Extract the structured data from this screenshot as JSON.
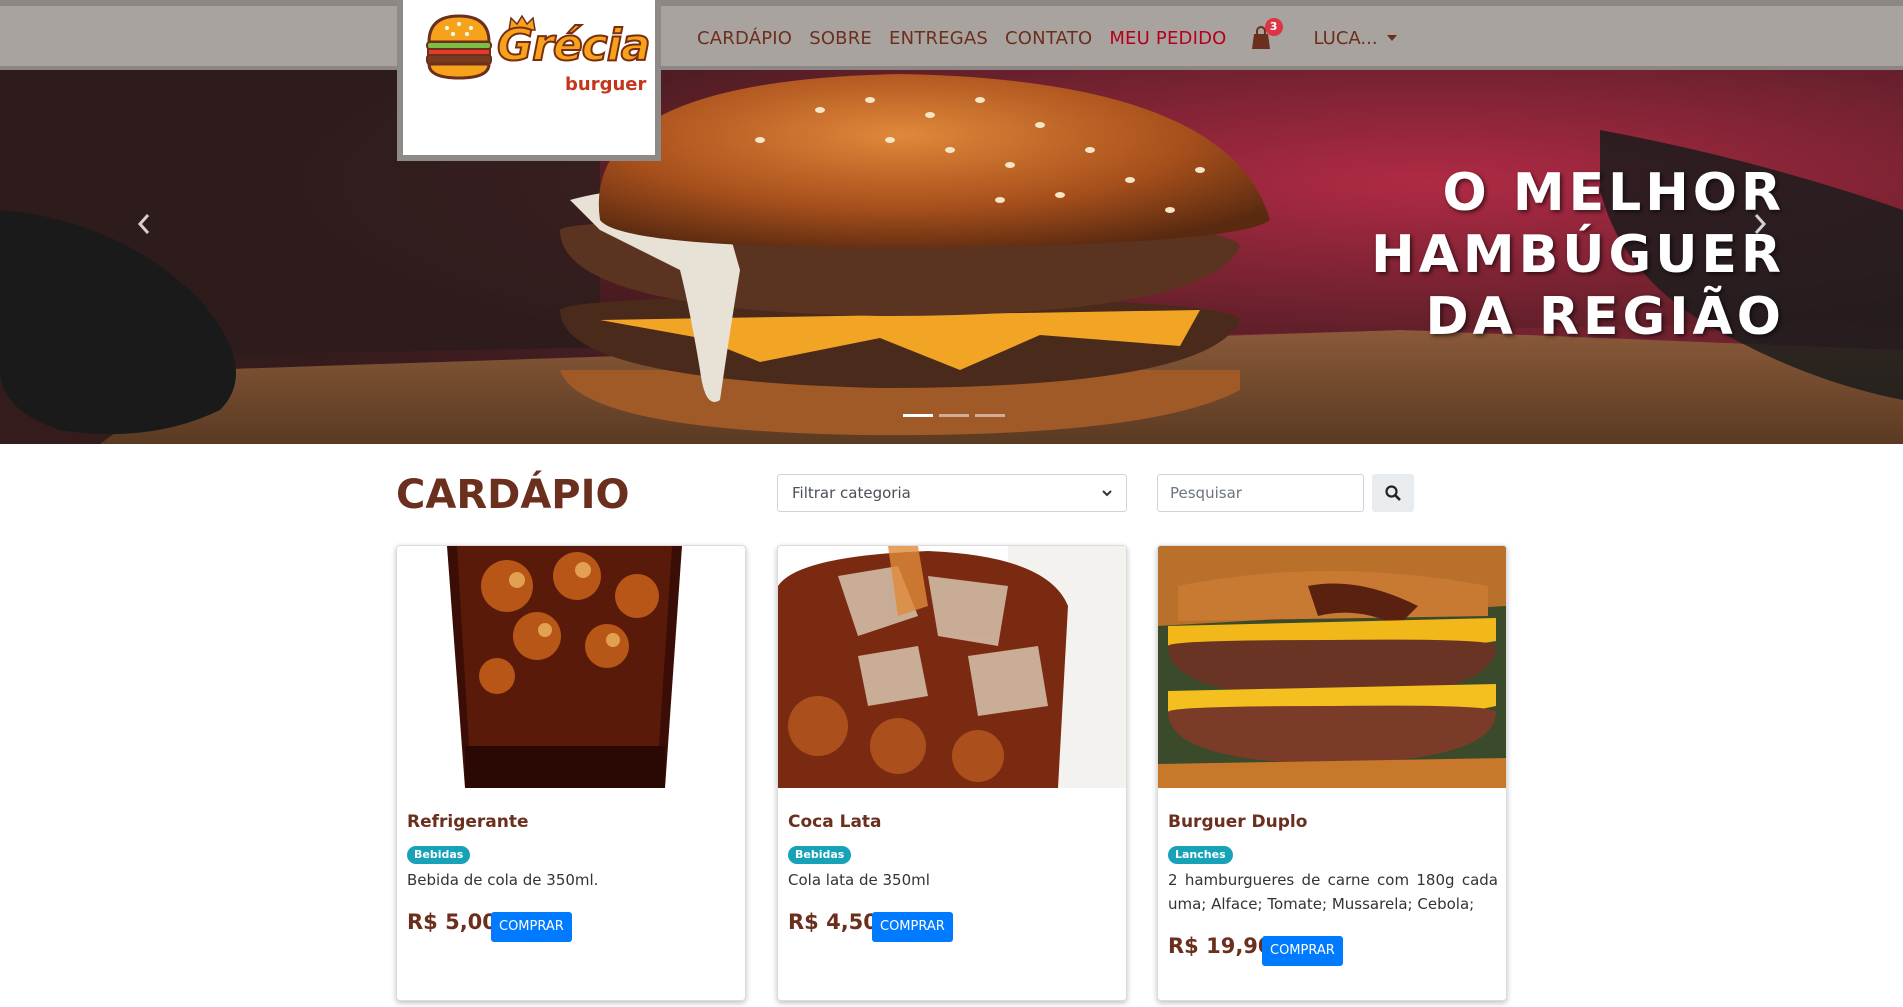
{
  "brand": {
    "name": "Grécia",
    "sub": "burguer"
  },
  "nav": {
    "items": [
      "CARDÁPIO",
      "SOBRE",
      "ENTREGAS",
      "CONTATO"
    ],
    "active_item": "MEU PEDIDO",
    "cart_count": "3",
    "user": "LUCA..."
  },
  "hero": {
    "line1": "O MELHOR",
    "line2": "HAMBÚGUER",
    "line3": "DA REGIÃO",
    "slide_count": 3,
    "active_slide": 1,
    "prev_icon": "chevron-left-icon",
    "next_icon": "chevron-right-icon"
  },
  "menu": {
    "title": "CARDÁPIO",
    "filter_placeholder": "Filtrar categoria",
    "search_placeholder": "Pesquisar",
    "search_icon": "search-icon",
    "buy_label": "COMPRAR",
    "products": [
      {
        "name": "Refrigerante",
        "category": "Bebidas",
        "description": "Bebida de cola de 350ml.",
        "price": "R$ 5,00"
      },
      {
        "name": "Coca Lata",
        "category": "Bebidas",
        "description": "Cola lata de 350ml",
        "price": "R$ 4,50"
      },
      {
        "name": "Burguer Duplo",
        "category": "Lanches",
        "description": "2 hamburgueres de carne com 180g cada uma; Alface; Tomate; Mussarela; Cebola;",
        "price": "R$ 19,90"
      }
    ]
  },
  "colors": {
    "brand_brown": "#6b2f1e",
    "active_red": "#b3001b",
    "navbar": "#a9a39f",
    "badge_teal": "#17a2b8",
    "button_blue": "#007bff"
  }
}
